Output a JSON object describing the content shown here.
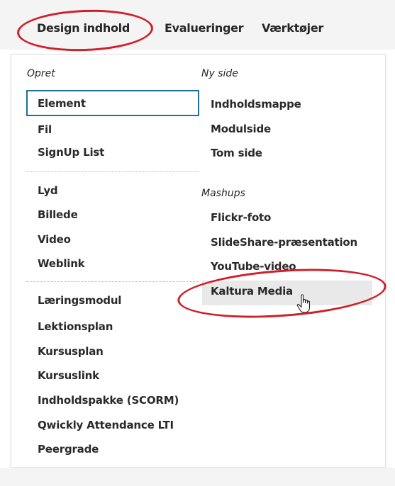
{
  "nav": {
    "tabs": [
      {
        "label": "Design indhold"
      },
      {
        "label": "Evalueringer"
      },
      {
        "label": "Værktøjer"
      }
    ]
  },
  "menu": {
    "opret": {
      "label": "Opret",
      "group1": [
        "Element",
        "Fil",
        "SignUp List"
      ],
      "group2": [
        "Lyd",
        "Billede",
        "Video",
        "Weblink"
      ],
      "group3": [
        "Læringsmodul",
        "Lektionsplan",
        "Kursusplan",
        "Kursuslink",
        "Indholdspakke (SCORM)",
        "Qwickly Attendance LTI",
        "Peergrade"
      ]
    },
    "ny_side": {
      "label": "Ny side",
      "items": [
        "Indholdsmappe",
        "Modulside",
        "Tom side"
      ]
    },
    "mashups": {
      "label": "Mashups",
      "items": [
        "Flickr-foto",
        "SlideShare-præsentation",
        "YouTube-video",
        "Kaltura Media"
      ]
    },
    "selected_item": "Element",
    "hovered_item": "Kaltura Media"
  },
  "colors": {
    "annotation_red": "#cf1f2a",
    "selection_blue": "#1f6f9a",
    "hover_gray": "#e9e9e9"
  },
  "icons": {
    "cursor": "hand-pointer-icon"
  }
}
